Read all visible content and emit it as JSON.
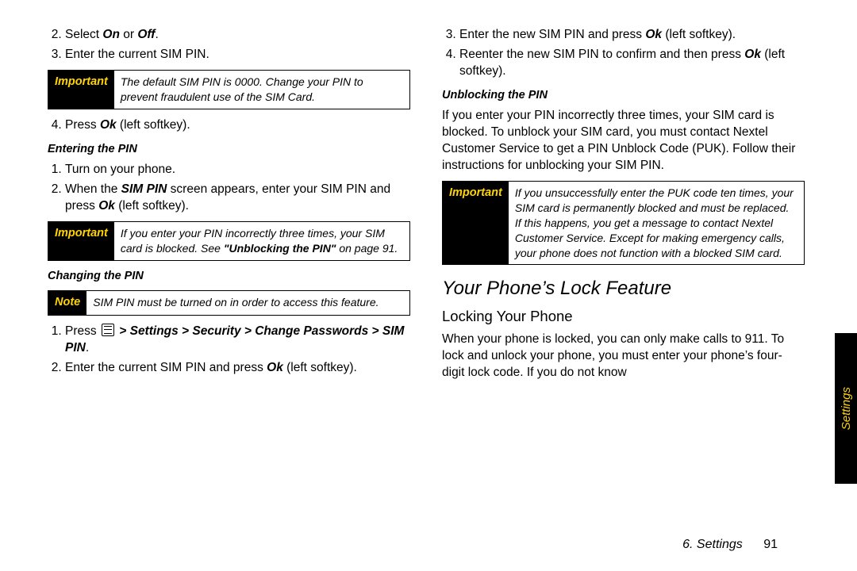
{
  "left": {
    "li2": "Select ",
    "li2on": "On",
    "li2or": " or ",
    "li2off": "Off",
    "li2end": ".",
    "li3": "Enter the current SIM PIN.",
    "imp1_label": "Important",
    "imp1_body": "The default SIM PIN is 0000. Change your PIN to prevent fraudulent use of the SIM Card.",
    "li4a": "Press ",
    "li4b": "Ok",
    "li4c": " (left softkey).",
    "sub1": "Entering the PIN",
    "e1": "Turn on your phone.",
    "e2a": "When the ",
    "e2b": "SIM PIN",
    "e2c": " screen appears, enter your SIM PIN and press ",
    "e2d": "Ok",
    "e2e": " (left softkey).",
    "imp2_label": "Important",
    "imp2_body_a": "If you enter your PIN incorrectly three times, your SIM card is blocked. See ",
    "imp2_body_b": "\"Unblocking the PIN\"",
    "imp2_body_c": " on page 91.",
    "sub2": "Changing the PIN",
    "note_label": "Note",
    "note_body": "SIM PIN must be turned on in order to access this feature.",
    "c1a": "Press ",
    "c1path": " > Settings > Security > Change Passwords > ",
    "c1sim": "SIM PIN",
    "c1end": ".",
    "c2a": "Enter the current SIM PIN and press ",
    "c2b": "Ok",
    "c2c": " (left softkey)."
  },
  "right": {
    "li3a": "Enter the new SIM PIN and press ",
    "li3b": "Ok",
    "li3c": " (left softkey).",
    "li4a": "Reenter the new SIM PIN to confirm and then press ",
    "li4b": "Ok",
    "li4c": " (left softkey).",
    "sub1": "Unblocking the PIN",
    "p1": "If you enter your PIN incorrectly three times, your SIM card is blocked. To unblock your SIM card, you must contact Nextel Customer Service to get a PIN Unblock Code (PUK). Follow their instructions for unblocking your SIM PIN.",
    "imp_label": "Important",
    "imp_body": "If you unsuccessfully enter the PUK code ten times, your SIM card is permanently blocked and must be replaced. If this happens, you get a message to contact Nextel Customer Service. Except for making emergency calls, your phone does not function with a blocked SIM card.",
    "h2": "Your Phone’s Lock Feature",
    "h3": "Locking Your Phone",
    "p2": "When your phone is locked, you can only make calls to 911. To lock and unlock your phone, you must enter your phone’s four-digit lock code. If you do not know"
  },
  "sidetab": "Settings",
  "footer_section": "6. Settings",
  "footer_page": "91"
}
